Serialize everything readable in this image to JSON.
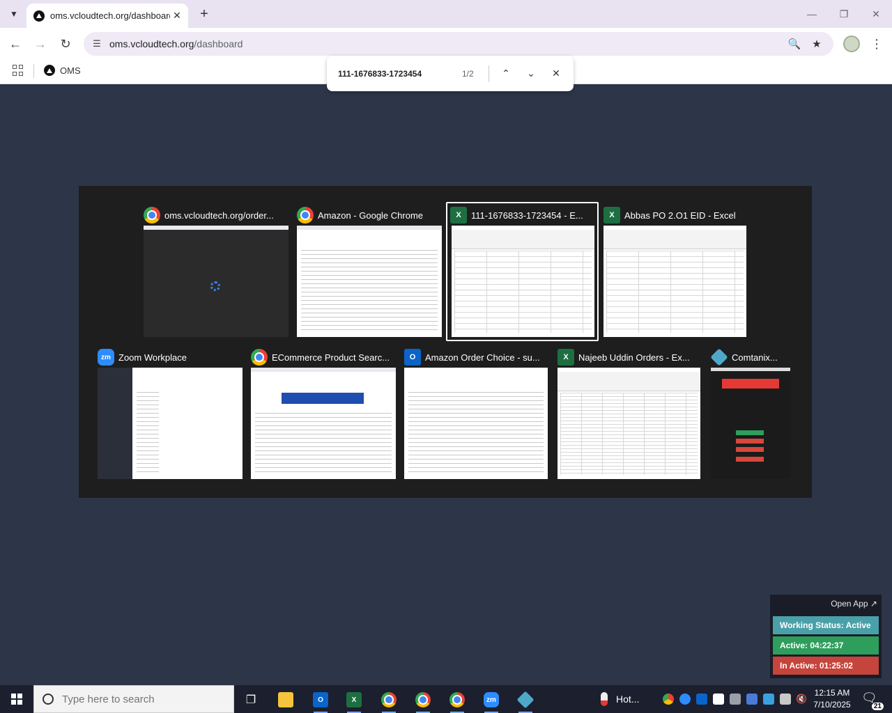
{
  "browser": {
    "tab_title": "oms.vcloudtech.org/dashboard",
    "url_host": "oms.vcloudtech.org",
    "url_path": "/dashboard",
    "bookmark_label": "OMS"
  },
  "find": {
    "query": "111-1676833-1723454",
    "count": "1/2"
  },
  "switcher": {
    "windows": [
      {
        "title": "oms.vcloudtech.org/order...",
        "app": "chrome"
      },
      {
        "title": "Amazon - Google Chrome",
        "app": "chrome"
      },
      {
        "title": "111-1676833-1723454 - E...",
        "app": "excel",
        "selected": true
      },
      {
        "title": "Abbas PO 2.O1  EID - Excel",
        "app": "excel"
      },
      {
        "title": "Zoom Workplace",
        "app": "zoom"
      },
      {
        "title": "ECommerce Product Searc...",
        "app": "chrome"
      },
      {
        "title": "Amazon Order Choice - su...",
        "app": "outlook"
      },
      {
        "title": "Najeeb Uddin Orders - Ex...",
        "app": "excel"
      },
      {
        "title": "Comtanix...",
        "app": "comtanix"
      }
    ]
  },
  "widget": {
    "open_app": "Open App ↗",
    "working_status": "Working Status: Active",
    "active": "Active: 04:22:37",
    "inactive": "In Active: 01:25:02"
  },
  "taskbar": {
    "search_placeholder": "Type here to search",
    "weather": "Hot...",
    "time": "12:15 AM",
    "date": "7/10/2025",
    "notifications": "21"
  },
  "icons": {
    "zoom_label": "zm",
    "excel_label": "X",
    "outlook_label": "O"
  },
  "colors": {
    "page_bg": "#2d3648",
    "working_status": "#4aa0a8",
    "active": "#2e9e5c",
    "inactive": "#c5443b"
  }
}
